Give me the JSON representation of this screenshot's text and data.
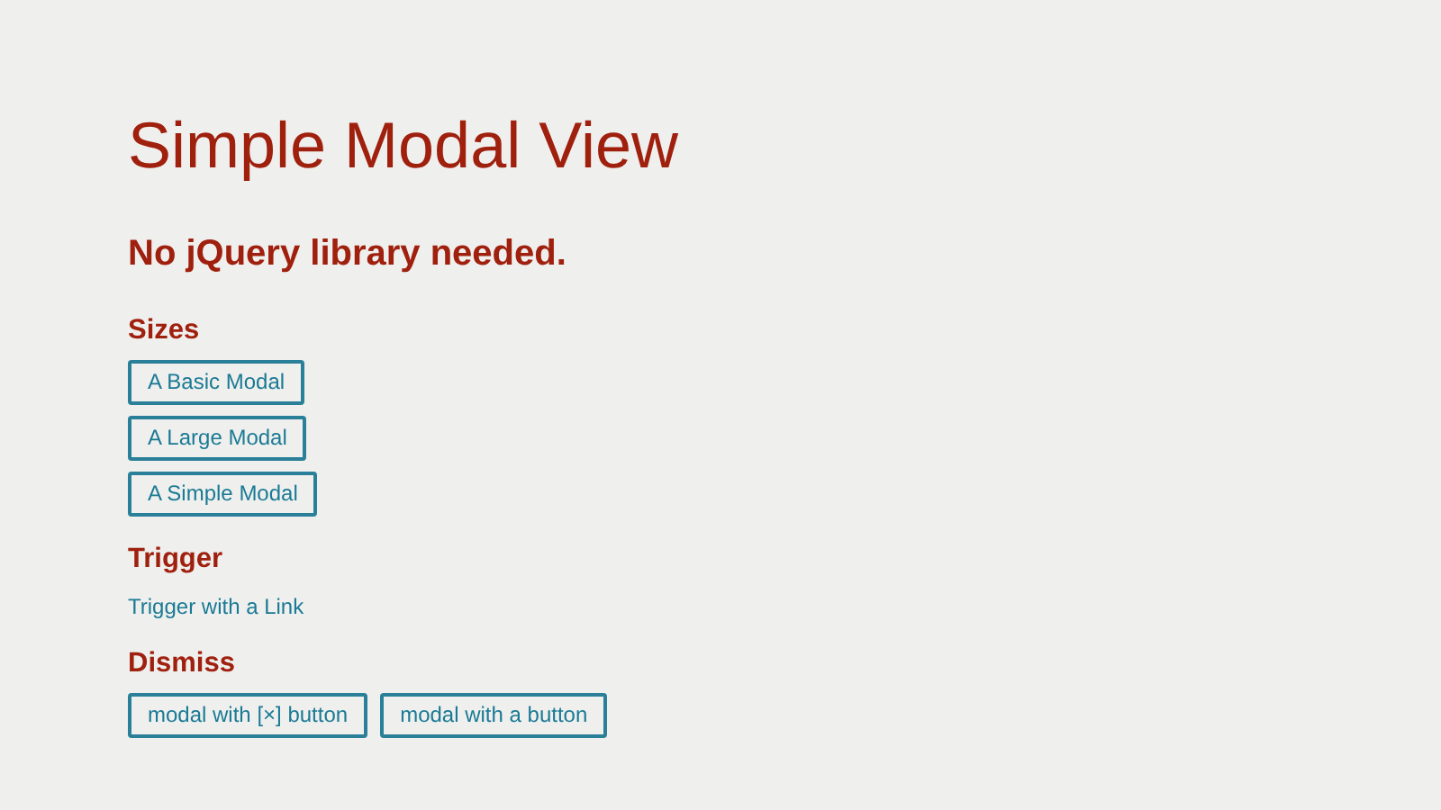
{
  "title": "Simple Modal View",
  "subtitle": "No jQuery library needed.",
  "sections": [
    {
      "heading": "Sizes",
      "kind": "stack",
      "items": [
        "A Basic Modal",
        "A Large Modal",
        "A Simple Modal"
      ]
    },
    {
      "heading": "Trigger",
      "kind": "link",
      "items": [
        "Trigger with a Link"
      ]
    },
    {
      "heading": "Dismiss",
      "kind": "row",
      "items": [
        "modal with [×] button",
        "modal with a button"
      ]
    }
  ]
}
